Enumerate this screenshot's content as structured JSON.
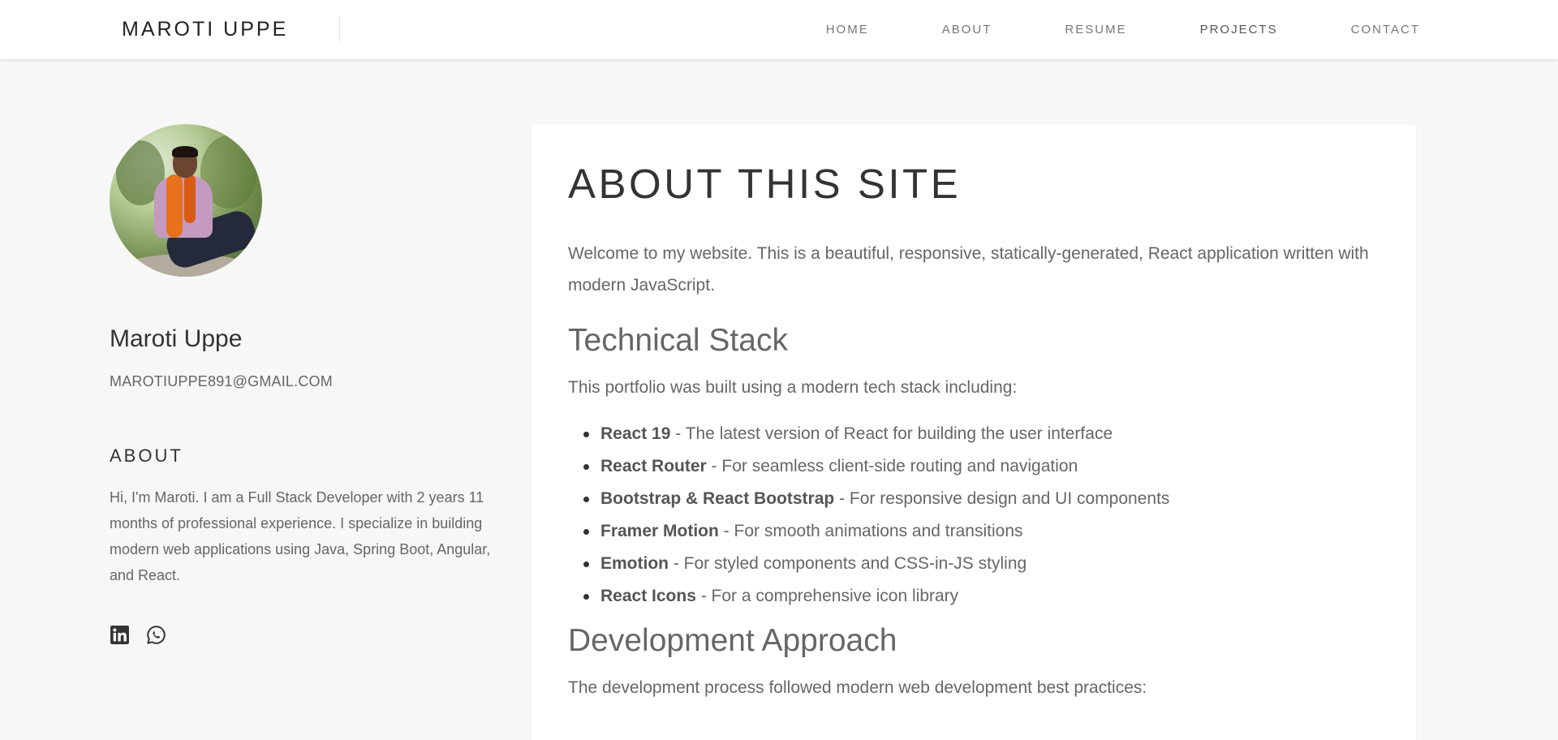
{
  "header": {
    "brand": "MAROTI UPPE",
    "nav": [
      {
        "label": "HOME"
      },
      {
        "label": "ABOUT"
      },
      {
        "label": "RESUME"
      },
      {
        "label": "PROJECTS"
      },
      {
        "label": "CONTACT"
      }
    ]
  },
  "sidebar": {
    "avatar_icon": "profile-photo",
    "name": "Maroti Uppe",
    "email": "MAROTIUPPE891@GMAIL.COM",
    "about_heading": "ABOUT",
    "about_text": "Hi, I'm Maroti. I am a Full Stack Developer with 2 years 11 months of professional experience. I specialize in building modern web applications using Java, Spring Boot, Angular, and React.",
    "socials": [
      {
        "icon": "linkedin-icon"
      },
      {
        "icon": "whatsapp-icon"
      }
    ]
  },
  "main": {
    "title": "ABOUT THIS SITE",
    "intro": "Welcome to my website. This is a beautiful, responsive, statically-generated, React application written with modern JavaScript.",
    "stack_heading": "Technical Stack",
    "stack_intro": "This portfolio was built using a modern tech stack including:",
    "stack_items": [
      {
        "name": "React 19",
        "desc": " - The latest version of React for building the user interface"
      },
      {
        "name": "React Router",
        "desc": " - For seamless client-side routing and navigation"
      },
      {
        "name": "Bootstrap & React Bootstrap",
        "desc": " - For responsive design and UI components"
      },
      {
        "name": "Framer Motion",
        "desc": " - For smooth animations and transitions"
      },
      {
        "name": "Emotion",
        "desc": " - For styled components and CSS-in-JS styling"
      },
      {
        "name": "React Icons",
        "desc": " - For a comprehensive icon library"
      }
    ],
    "dev_heading": "Development Approach",
    "dev_intro": "The development process followed modern web development best practices:"
  },
  "colors": {
    "page_background": "#f7f7f7",
    "card_background": "#ffffff",
    "heading": "#333333",
    "body_text": "#666666"
  }
}
